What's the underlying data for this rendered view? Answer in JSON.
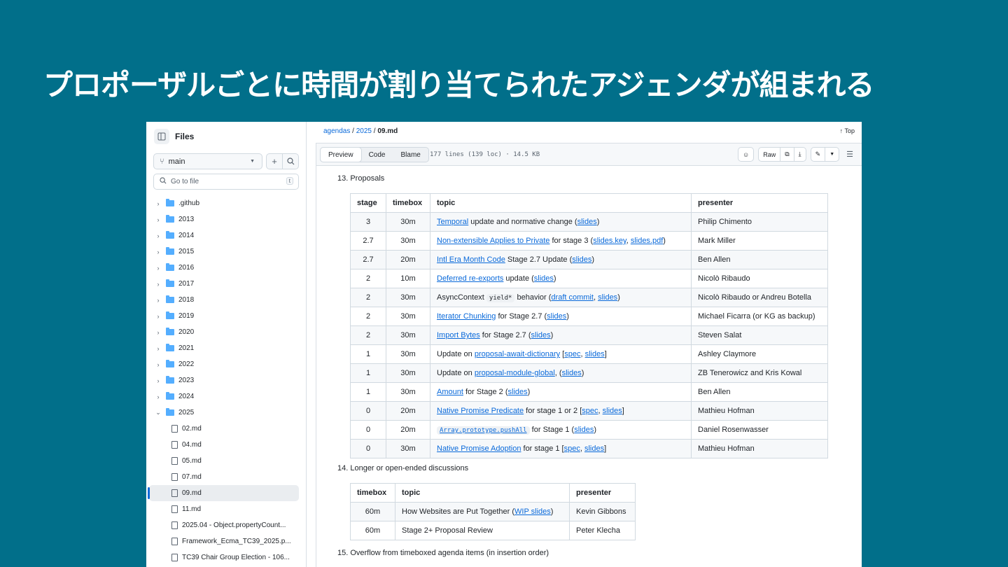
{
  "slide_title": "プロポーザルごとに時間が割り当てられたアジェンダが組まれる",
  "sidebar": {
    "title": "Files",
    "branch": "main",
    "goto_placeholder": "Go to file",
    "goto_shortcut": "t",
    "folders": [
      ".github",
      "2013",
      "2014",
      "2015",
      "2016",
      "2017",
      "2018",
      "2019",
      "2020",
      "2021",
      "2022",
      "2023",
      "2024"
    ],
    "open_folder": "2025",
    "files": [
      "02.md",
      "04.md",
      "05.md",
      "07.md",
      "09.md",
      "11.md",
      "2025.04 - Object.propertyCount...",
      "Framework_Ecma_TC39_2025.p...",
      "TC39 Chair Group Election - 106..."
    ],
    "selected_file": "09.md"
  },
  "header": {
    "crumbs": [
      "agendas",
      "2025",
      "09.md"
    ],
    "top": "Top",
    "tabs": [
      "Preview",
      "Code",
      "Blame"
    ],
    "meta": "177 lines (139 loc) · 14.5 KB",
    "raw": "Raw"
  },
  "section13": "13. Proposals",
  "table1": {
    "headers": [
      "stage",
      "timebox",
      "topic",
      "presenter"
    ],
    "rows": [
      {
        "stage": "3",
        "timebox": "30m",
        "topic": [
          {
            "t": "Temporal",
            "link": true
          },
          {
            "t": " update and normative change ("
          },
          {
            "t": "slides",
            "link": true
          },
          {
            "t": ")"
          }
        ],
        "presenter": "Philip Chimento"
      },
      {
        "stage": "2.7",
        "timebox": "30m",
        "topic": [
          {
            "t": "Non-extensible Applies to Private",
            "link": true
          },
          {
            "t": " for stage 3 ("
          },
          {
            "t": "slides.key",
            "link": true
          },
          {
            "t": ", "
          },
          {
            "t": "slides.pdf",
            "link": true
          },
          {
            "t": ")"
          }
        ],
        "presenter": "Mark Miller"
      },
      {
        "stage": "2.7",
        "timebox": "20m",
        "topic": [
          {
            "t": "Intl Era Month Code",
            "link": true
          },
          {
            "t": " Stage 2.7 Update ("
          },
          {
            "t": "slides",
            "link": true
          },
          {
            "t": ")"
          }
        ],
        "presenter": "Ben Allen"
      },
      {
        "stage": "2",
        "timebox": "10m",
        "topic": [
          {
            "t": "Deferred re-exports",
            "link": true
          },
          {
            "t": " update ("
          },
          {
            "t": "slides",
            "link": true
          },
          {
            "t": ")"
          }
        ],
        "presenter": "Nicolò Ribaudo"
      },
      {
        "stage": "2",
        "timebox": "30m",
        "topic": [
          {
            "t": "AsyncContext "
          },
          {
            "t": "yield*",
            "code": true
          },
          {
            "t": " behavior ("
          },
          {
            "t": "draft commit",
            "link": true
          },
          {
            "t": ", "
          },
          {
            "t": "slides",
            "link": true
          },
          {
            "t": ")"
          }
        ],
        "presenter": "Nicolò Ribaudo or Andreu Botella"
      },
      {
        "stage": "2",
        "timebox": "30m",
        "topic": [
          {
            "t": "Iterator Chunking",
            "link": true
          },
          {
            "t": " for Stage 2.7 ("
          },
          {
            "t": "slides",
            "link": true
          },
          {
            "t": ")"
          }
        ],
        "presenter": "Michael Ficarra (or KG as backup)"
      },
      {
        "stage": "2",
        "timebox": "30m",
        "topic": [
          {
            "t": "Import Bytes",
            "link": true
          },
          {
            "t": " for Stage 2.7 ("
          },
          {
            "t": "slides",
            "link": true
          },
          {
            "t": ")"
          }
        ],
        "presenter": "Steven Salat"
      },
      {
        "stage": "1",
        "timebox": "30m",
        "topic": [
          {
            "t": "Update on "
          },
          {
            "t": "proposal-await-dictionary",
            "link": true
          },
          {
            "t": " ["
          },
          {
            "t": "spec",
            "link": true
          },
          {
            "t": ", "
          },
          {
            "t": "slides",
            "link": true
          },
          {
            "t": "]"
          }
        ],
        "presenter": "Ashley Claymore"
      },
      {
        "stage": "1",
        "timebox": "30m",
        "topic": [
          {
            "t": "Update on "
          },
          {
            "t": "proposal-module-global",
            "link": true
          },
          {
            "t": ", ("
          },
          {
            "t": "slides",
            "link": true
          },
          {
            "t": ")"
          }
        ],
        "presenter": "ZB Tenerowicz and Kris Kowal"
      },
      {
        "stage": "1",
        "timebox": "30m",
        "topic": [
          {
            "t": "Amount",
            "link": true
          },
          {
            "t": " for Stage 2 ("
          },
          {
            "t": "slides",
            "link": true
          },
          {
            "t": ")"
          }
        ],
        "presenter": "Ben Allen"
      },
      {
        "stage": "0",
        "timebox": "20m",
        "topic": [
          {
            "t": "Native Promise Predicate",
            "link": true
          },
          {
            "t": " for stage 1 or 2 ["
          },
          {
            "t": "spec",
            "link": true
          },
          {
            "t": ", "
          },
          {
            "t": "slides",
            "link": true
          },
          {
            "t": "]"
          }
        ],
        "presenter": "Mathieu Hofman"
      },
      {
        "stage": "0",
        "timebox": "20m",
        "topic": [
          {
            "t": "Array.prototype.pushAll",
            "code": true,
            "link": true
          },
          {
            "t": " for Stage 1 ("
          },
          {
            "t": "slides",
            "link": true
          },
          {
            "t": ")"
          }
        ],
        "presenter": "Daniel Rosenwasser"
      },
      {
        "stage": "0",
        "timebox": "30m",
        "topic": [
          {
            "t": "Native Promise Adoption",
            "link": true
          },
          {
            "t": " for stage 1 ["
          },
          {
            "t": "spec",
            "link": true
          },
          {
            "t": ", "
          },
          {
            "t": "slides",
            "link": true
          },
          {
            "t": "]"
          }
        ],
        "presenter": "Mathieu Hofman"
      }
    ]
  },
  "section14": "14. Longer or open-ended discussions",
  "table2": {
    "headers": [
      "timebox",
      "topic",
      "presenter"
    ],
    "rows": [
      {
        "timebox": "60m",
        "topic": [
          {
            "t": "How Websites are Put Together ("
          },
          {
            "t": "WIP slides",
            "link": true
          },
          {
            "t": ")"
          }
        ],
        "presenter": "Kevin Gibbons"
      },
      {
        "timebox": "60m",
        "topic": [
          {
            "t": "Stage 2+ Proposal Review"
          }
        ],
        "presenter": "Peter Klecha"
      }
    ]
  },
  "section15": "15. Overflow from timeboxed agenda items (in insertion order)"
}
